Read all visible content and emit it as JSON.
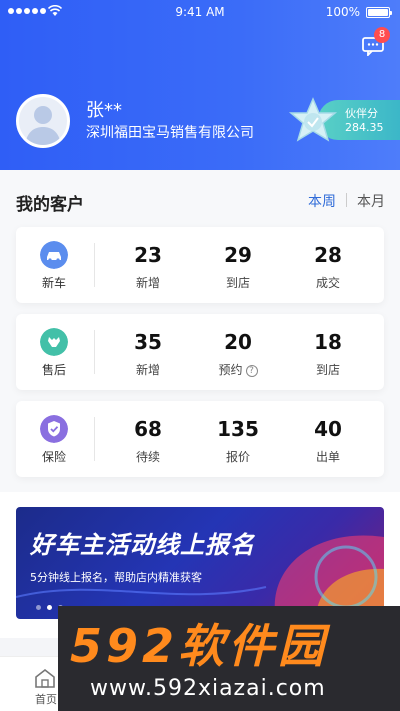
{
  "status_bar": {
    "time": "9:41 AM",
    "battery": "100%"
  },
  "header": {
    "message_badge": "8",
    "user_name": "张**",
    "company": "深圳福田宝马销售有限公司",
    "partner_label": "伙伴分",
    "partner_score": "284.35"
  },
  "customers": {
    "title": "我的客户",
    "period_week": "本周",
    "period_month": "本月",
    "rows": [
      {
        "label": "新车",
        "icon": "car-icon",
        "stats": [
          {
            "value": "23",
            "label": "新增"
          },
          {
            "value": "29",
            "label": "到店"
          },
          {
            "value": "28",
            "label": "成交"
          }
        ]
      },
      {
        "label": "售后",
        "icon": "after-sales-icon",
        "stats": [
          {
            "value": "35",
            "label": "新增"
          },
          {
            "value": "20",
            "label": "预约"
          },
          {
            "value": "18",
            "label": "到店"
          }
        ]
      },
      {
        "label": "保险",
        "icon": "insurance-shield-icon",
        "stats": [
          {
            "value": "68",
            "label": "待续"
          },
          {
            "value": "135",
            "label": "报价"
          },
          {
            "value": "40",
            "label": "出单"
          }
        ]
      }
    ]
  },
  "banner": {
    "title": "好车主活动线上报名",
    "subtitle": "5分钟线上报名，帮助店内精准获客"
  },
  "tabbar": {
    "home_label": "首页"
  },
  "watermark": {
    "brand": "592软件园",
    "url": "www.592xiazai.com"
  },
  "colors": {
    "header_blue": "#2f5ef6",
    "accent_link": "#2f6bd8",
    "badge_red": "#ff4d4f",
    "partner_teal": "#3bb6c8"
  }
}
